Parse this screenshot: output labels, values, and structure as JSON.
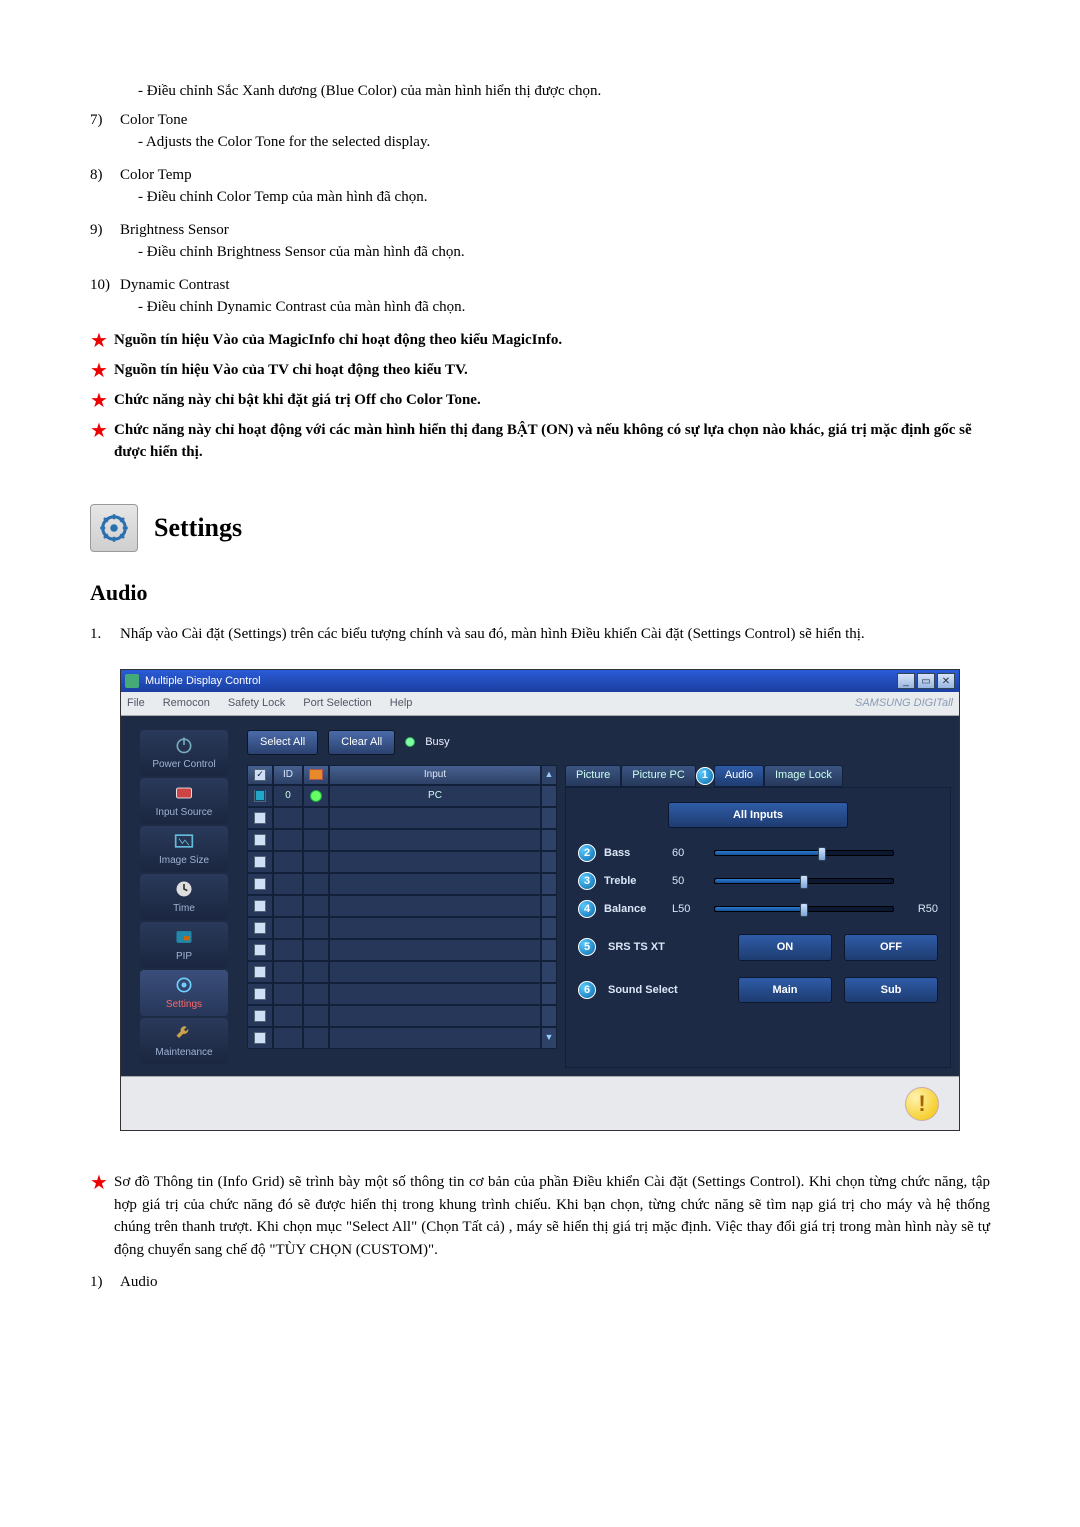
{
  "doc": {
    "blue_color_line": "- Điều chỉnh Sắc Xanh dương (Blue Color) của màn hình hiển thị được chọn.",
    "item7_num": "7)",
    "item7_title": "Color Tone",
    "item7_sub": "- Adjusts the Color Tone for the selected display.",
    "item8_num": "8)",
    "item8_title": "Color Temp",
    "item8_sub": "- Điều chỉnh Color Temp của màn hình đã chọn.",
    "item9_num": "9)",
    "item9_title": "Brightness Sensor",
    "item9_sub": "- Điều chỉnh Brightness Sensor của màn hình đã chọn.",
    "item10_num": "10)",
    "item10_title": "Dynamic Contrast",
    "item10_sub": "- Điều chỉnh Dynamic Contrast của màn hình đã chọn.",
    "star1": "Nguồn tín hiệu Vào của MagicInfo chỉ hoạt động theo kiểu MagicInfo.",
    "star2": "Nguồn tín hiệu Vào của TV chỉ hoạt động theo kiểu TV.",
    "star3": "Chức năng này chỉ bật khi đặt giá trị Off cho Color Tone.",
    "star4": "Chức năng này chỉ hoạt động với các màn hình hiển thị đang BẬT (ON) và nếu không có sự lựa chọn nào khác, giá trị mặc định gốc sẽ được hiển thị.",
    "settings_heading": "Settings",
    "audio_heading": "Audio",
    "audio_intro_num": "1.",
    "audio_intro": "Nhấp vào Cài đặt (Settings) trên các biểu tượng chính và sau đó, màn hình Điều khiển Cài đặt (Settings Control) sẽ hiển thị.",
    "bottom_note": "Sơ đồ Thông tin (Info Grid) sẽ trình bày một số thông tin cơ bản của phần Điều khiển Cài đặt (Settings Control). Khi chọn từng chức năng, tập hợp giá trị của chức năng đó sẽ được hiển thị trong khung trình chiếu. Khi bạn chọn, từng chức năng sẽ tìm nạp giá trị cho máy và hệ thống chúng trên thanh trượt. Khi chọn mục \"Select All\" (Chọn Tất cả) , máy sẽ hiển thị giá trị mặc định. Việc thay đổi giá trị trong màn hình này sẽ tự động chuyển sang chế độ \"TÙY CHỌN (CUSTOM)\".",
    "item_audio_num": "1)",
    "item_audio_title": "Audio"
  },
  "app": {
    "title": "Multiple Display Control",
    "brand": "SAMSUNG DIGITall",
    "menus": {
      "file": "File",
      "remocon": "Remocon",
      "safety": "Safety Lock",
      "port": "Port Selection",
      "help": "Help"
    },
    "side": {
      "power": "Power Control",
      "input": "Input Source",
      "image": "Image Size",
      "time": "Time",
      "pip": "PIP",
      "settings": "Settings",
      "maint": "Maintenance"
    },
    "topbar": {
      "select_all": "Select All",
      "clear_all": "Clear All",
      "busy": "Busy"
    },
    "grid": {
      "hdr_id": "ID",
      "hdr_input": "Input",
      "row0_id": "0",
      "row0_input": "PC"
    },
    "tabs": {
      "picture": "Picture",
      "picture_pc": "Picture PC",
      "audio": "Audio",
      "image_lock": "Image Lock"
    },
    "callouts": {
      "c1": "1",
      "c2": "2",
      "c3": "3",
      "c4": "4",
      "c5": "5",
      "c6": "6"
    },
    "audio": {
      "all_inputs": "All Inputs",
      "bass_label": "Bass",
      "bass_val": "60",
      "treble_label": "Treble",
      "treble_val": "50",
      "balance_label": "Balance",
      "balance_val": "L50",
      "balance_right": "R50",
      "srs_label": "SRS TS XT",
      "on": "ON",
      "off": "OFF",
      "sound_select_label": "Sound Select",
      "main": "Main",
      "sub": "Sub"
    }
  }
}
